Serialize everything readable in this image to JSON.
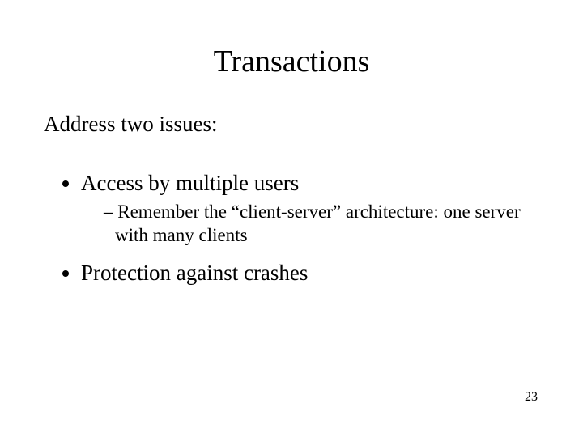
{
  "slide": {
    "title": "Transactions",
    "intro": "Address two issues:",
    "bullets": [
      {
        "text": "Access by multiple users",
        "sub": [
          "Remember the “client-server” architecture: one server with many clients"
        ]
      },
      {
        "text": "Protection against crashes",
        "sub": []
      }
    ],
    "page_number": "23"
  }
}
